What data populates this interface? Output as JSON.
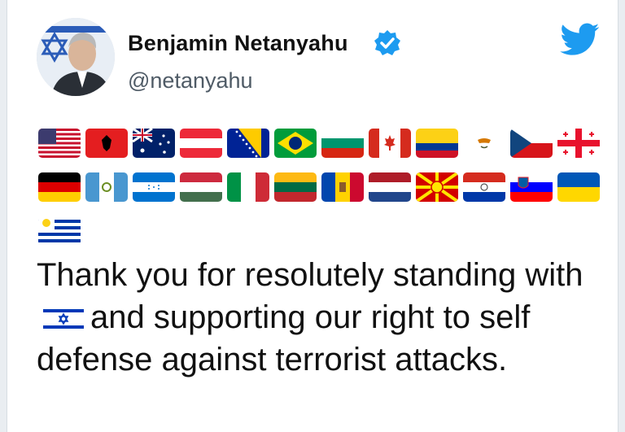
{
  "author": {
    "name": "Benjamin Netanyahu",
    "handle": "@netanyahu",
    "verified": true
  },
  "brand": {
    "icon": "twitter-bird-icon",
    "color": "#1d9bf0"
  },
  "flags_row1": [
    "flag-united-states",
    "flag-albania",
    "flag-australia",
    "flag-austria",
    "flag-bosnia-herzegovina",
    "flag-brazil",
    "flag-bulgaria",
    "flag-canada",
    "flag-colombia",
    "flag-cyprus",
    "flag-czech-republic",
    "flag-georgia"
  ],
  "flags_row2": [
    "flag-germany",
    "flag-guatemala",
    "flag-honduras",
    "flag-hungary",
    "flag-italy",
    "flag-lithuania",
    "flag-moldova",
    "flag-netherlands",
    "flag-north-macedonia",
    "flag-paraguay",
    "flag-slovenia",
    "flag-ukraine"
  ],
  "flags_row3": [
    "flag-uruguay"
  ],
  "tweet": {
    "part1": "Thank you for resolutely standing with",
    "inline_flag": "flag-israel",
    "part2": "and supporting our right to self defense against terrorist attacks."
  }
}
